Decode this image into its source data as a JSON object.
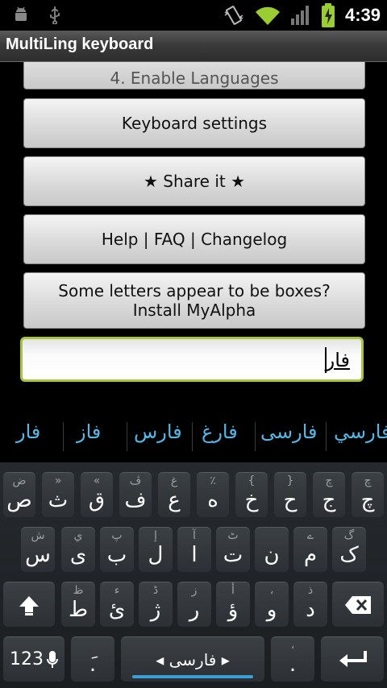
{
  "status_bar": {
    "time": "4:39",
    "icons_left": [
      "android-debug-icon",
      "usb-icon"
    ],
    "icons_right": [
      "vibrate-icon",
      "wifi-icon",
      "signal-icon",
      "battery-charging-icon"
    ]
  },
  "app": {
    "title": "MultiLing keyboard"
  },
  "buttons": {
    "enable_languages": "4. Enable Languages",
    "keyboard_settings": "Keyboard settings",
    "share_it": "★ Share it ★",
    "help": "Help | FAQ | Changelog",
    "boxes_line1": "Some letters appear to be boxes?",
    "boxes_line2": "Install MyAlpha"
  },
  "input": {
    "value": "فار"
  },
  "suggestions": [
    "فار",
    "فاز",
    "فارس",
    "فارغ",
    "فارسی",
    "فارسي"
  ],
  "keyboard": {
    "row1": [
      {
        "m": "ص",
        "h": "ض"
      },
      {
        "m": "ث",
        "h": "»"
      },
      {
        "m": "ق",
        "h": "«"
      },
      {
        "m": "ف",
        "h": "ڤ"
      },
      {
        "m": "ع",
        "h": "غ"
      },
      {
        "m": "ه",
        "h": "٪"
      },
      {
        "m": "خ",
        "h": "{"
      },
      {
        "m": "ح",
        "h": "}"
      },
      {
        "m": "ج",
        "h": "چ"
      },
      {
        "m": "چ",
        "h": "چ"
      }
    ],
    "row2": [
      {
        "m": "س",
        "h": "ش"
      },
      {
        "m": "ی",
        "h": "ي"
      },
      {
        "m": "ب",
        "h": "پ"
      },
      {
        "m": "ل",
        "h": "إ"
      },
      {
        "m": "ا",
        "h": "آ"
      },
      {
        "m": "ت",
        "h": "ٹ"
      },
      {
        "m": "ن",
        "h": ""
      },
      {
        "m": "م",
        "h": "ے"
      },
      {
        "m": "ک",
        "h": "گ"
      }
    ],
    "row3": [
      {
        "m": "ط",
        "h": "ظ"
      },
      {
        "m": "ئ",
        "h": "ء"
      },
      {
        "m": "ژ",
        "h": "ڈ"
      },
      {
        "m": "ر",
        "h": "ز"
      },
      {
        "m": "ؤ",
        "h": "أ"
      },
      {
        "m": "و",
        "h": "،"
      },
      {
        "m": "د",
        "h": "ذ"
      }
    ],
    "numbers_label": "123",
    "left_punct": "َ.",
    "space_label": "◂ فارسی ▸",
    "period": ".",
    "period_hint": "،"
  },
  "colors": {
    "accent_blue": "#54b7e6",
    "edit_border": "#a9c43b",
    "space_underline": "#3a9fd6"
  }
}
